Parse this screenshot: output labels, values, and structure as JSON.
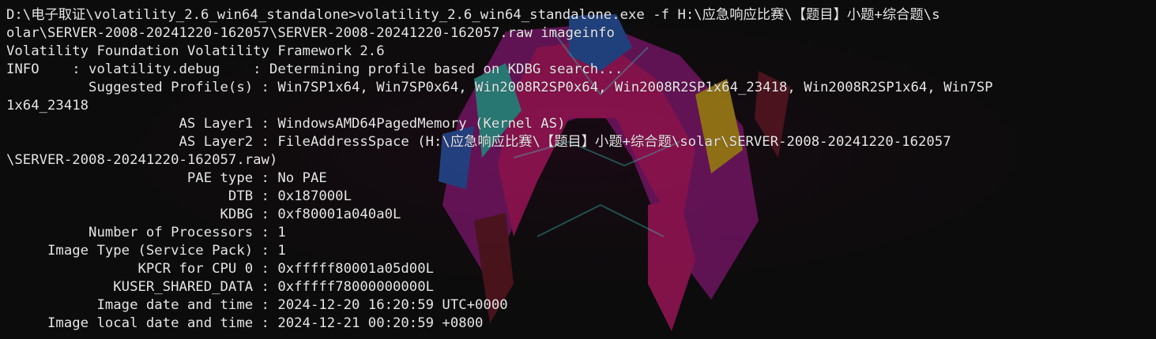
{
  "terminal": {
    "foreground": "#e6e6e6",
    "background": "#0c0c0c",
    "background_art_colors": [
      "#e0197b",
      "#a21a8c",
      "#2f6bd6",
      "#f2c21b",
      "#3bd0c4",
      "#7a1a2a"
    ],
    "lines": [
      "D:\\电子取证\\volatility_2.6_win64_standalone>volatility_2.6_win64_standalone.exe -f H:\\应急响应比赛\\【题目】小题+综合题\\s",
      "olar\\SERVER-2008-20241220-162057\\SERVER-2008-20241220-162057.raw imageinfo",
      "Volatility Foundation Volatility Framework 2.6",
      "INFO    : volatility.debug    : Determining profile based on KDBG search...",
      "          Suggested Profile(s) : Win7SP1x64, Win7SP0x64, Win2008R2SP0x64, Win2008R2SP1x64_23418, Win2008R2SP1x64, Win7SP",
      "1x64_23418",
      "                     AS Layer1 : WindowsAMD64PagedMemory (Kernel AS)",
      "                     AS Layer2 : FileAddressSpace (H:\\应急响应比赛\\【题目】小题+综合题\\solar\\SERVER-2008-20241220-162057",
      "\\SERVER-2008-20241220-162057.raw)",
      "                      PAE type : No PAE",
      "                           DTB : 0x187000L",
      "                          KDBG : 0xf80001a040a0L",
      "          Number of Processors : 1",
      "     Image Type (Service Pack) : 1",
      "                KPCR for CPU 0 : 0xfffff80001a05d00L",
      "             KUSER_SHARED_DATA : 0xfffff78000000000L",
      "           Image date and time : 2024-12-20 16:20:59 UTC+0000",
      "     Image local date and time : 2024-12-21 00:20:59 +0800"
    ]
  }
}
